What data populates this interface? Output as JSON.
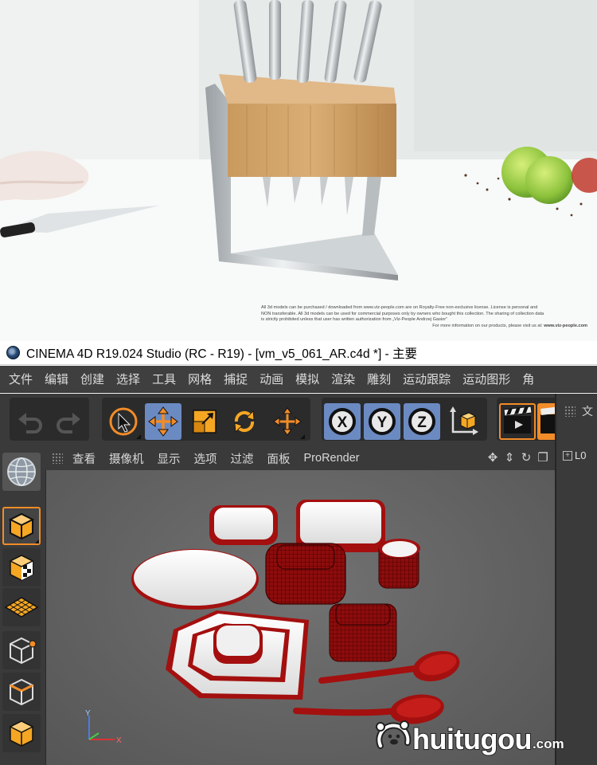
{
  "photo": {
    "notice_lines": [
      "All 3d models can be purchased / downloaded from www.viz-people.com are on Royalty-Free non-exclusive license. License is personal and",
      "NON transferable. All 3d models can be used for commercial purposes only by owners who bought this collection. The sharing of collection data",
      "is strictly prohibited unless that user has written authorization from „Viz-People Andrzej Gasior”"
    ],
    "more_info": "For more information on our products, please visit us at: ",
    "more_info_url": "www.viz-people.com"
  },
  "window": {
    "title": "CINEMA 4D R19.024 Studio (RC - R19) - [vm_v5_061_AR.c4d *] - 主要",
    "app_icon": "cinema4d-icon"
  },
  "menubar": {
    "items": [
      "文件",
      "编辑",
      "创建",
      "选择",
      "工具",
      "网格",
      "捕捉",
      "动画",
      "模拟",
      "渲染",
      "雕刻",
      "运动跟踪",
      "运动图形",
      "角"
    ]
  },
  "toolbar": {
    "axis_x": "X",
    "axis_y": "Y",
    "axis_z": "Z",
    "icons": [
      "undo-icon",
      "redo-icon",
      "live-select-icon",
      "move-icon",
      "scale-icon",
      "rotate-icon",
      "recent-tool-icon",
      "lock-x-icon",
      "lock-y-icon",
      "lock-z-icon",
      "coordinate-system-icon",
      "render-view-icon",
      "render-to-picture-viewer-icon"
    ]
  },
  "viewport": {
    "menu": [
      "查看",
      "摄像机",
      "显示",
      "选项",
      "过滤",
      "面板",
      "ProRender"
    ],
    "axis_labels": {
      "x": "X",
      "y": "Y"
    }
  },
  "right_panel": {
    "tab_label": "文",
    "row_label": "L0"
  },
  "watermark": {
    "text": "huitugou",
    "suffix": ".com"
  },
  "colors": {
    "menu_bg": "#3f3f3f",
    "toolbar_bg": "#3a3a3a",
    "active_blue": "#6b8ac2",
    "accent_orange": "#f28c28",
    "dish_red": "#9e0d0d"
  }
}
